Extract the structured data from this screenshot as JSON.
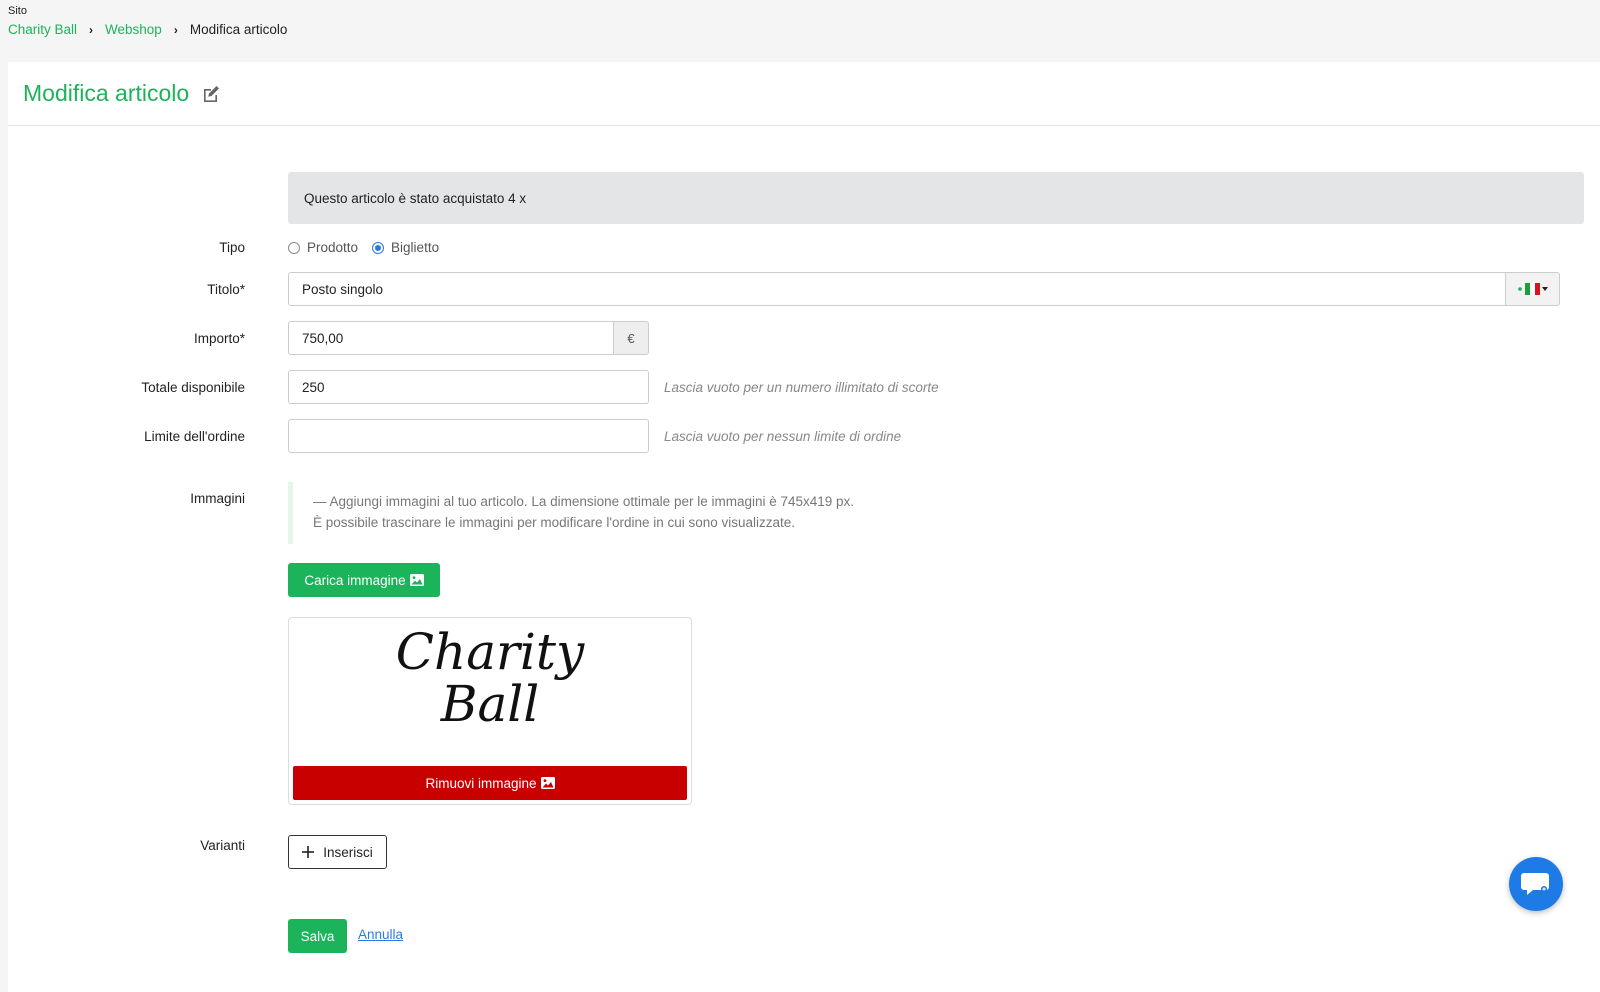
{
  "top_label": "Sito",
  "breadcrumb": {
    "items": [
      "Charity Ball",
      "Webshop"
    ],
    "separator": "›",
    "current": "Modifica articolo"
  },
  "header": {
    "title": "Modifica articolo",
    "icon": "edit-icon"
  },
  "alert": {
    "text": "Questo articolo è stato acquistato 4 x"
  },
  "form": {
    "tipo": {
      "label": "Tipo",
      "options": [
        "Prodotto",
        "Biglietto"
      ],
      "selected": "Biglietto"
    },
    "titolo": {
      "label": "Titolo*",
      "value": "Posto singolo",
      "language_flag": "italy-flag-icon"
    },
    "importo": {
      "label": "Importo*",
      "value": "750,00",
      "currency": "€"
    },
    "totale": {
      "label": "Totale disponibile",
      "value": "250",
      "hint": "Lascia vuoto per un numero illimitato di scorte"
    },
    "limite": {
      "label": "Limite dell'ordine",
      "value": "",
      "hint": "Lascia vuoto per nessun limite di ordine"
    },
    "immagini": {
      "label": "Immagini",
      "info_line1": "— Aggiungi immagini al tuo articolo. La dimensione ottimale per le immagini è 745x419 px.",
      "info_line2": "È possibile trascinare le immagini per modificare l'ordine in cui sono visualizzate.",
      "upload_label": "Carica immagine",
      "remove_label": "Rimuovi immagine"
    },
    "varianti": {
      "label": "Varianti",
      "add_label": "Inserisci"
    }
  },
  "actions": {
    "save_label": "Salva",
    "cancel_label": "Annulla"
  },
  "colors": {
    "accent": "#1bb45a",
    "danger": "#c90000",
    "link": "#2a7ae2",
    "chat": "#1e7be6"
  }
}
